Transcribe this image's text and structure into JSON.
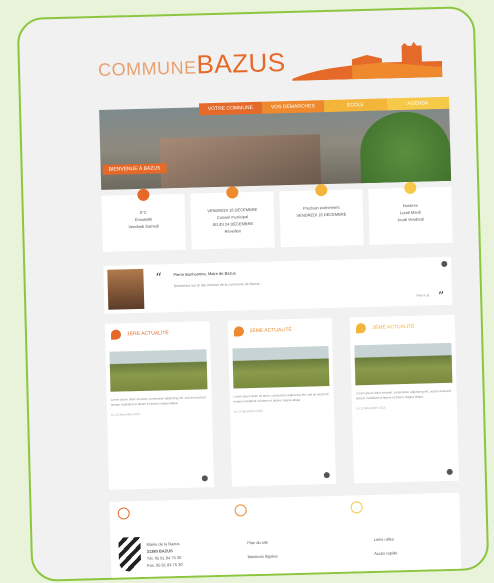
{
  "header": {
    "logo_prefix": "COMMUNE",
    "logo_name": "BAZUS"
  },
  "nav": {
    "items": [
      "VOTRE COMMUNE",
      "VOS DÉMARCHES",
      "ÉCOLE",
      "AGENDA"
    ],
    "colors": [
      "#e56a2a",
      "#ee8a2d",
      "#f3b53a",
      "#f6c949"
    ]
  },
  "hero": {
    "badge": "BIENVENUE À BAZUS"
  },
  "widgets": [
    {
      "icon": "weather-icon",
      "color": "#e56a2a",
      "lines": [
        "8°C",
        "Ensoleillé",
        "Vendredi  Samedi"
      ]
    },
    {
      "icon": "calendar-icon",
      "color": "#ee8a2d",
      "lines": [
        "VENDREDI 18 DÉCEMBRE",
        "Conseil municipal",
        "JEUDI 24 DÉCEMBRE",
        "Réveillon"
      ]
    },
    {
      "icon": "clock-icon",
      "color": "#f3b53a",
      "lines": [
        "Prochain événement",
        "VENDREDI 18 DÉCEMBRE"
      ]
    },
    {
      "icon": "chat-icon",
      "color": "#f6c949",
      "lines": [
        "Horaires",
        "Lundi    Mardi",
        "Jeudi    Vendredi"
      ]
    }
  ],
  "testimonial": {
    "title": "Pierre Bonhomme, Maire de Bazus",
    "body": "Bienvenue sur le site internet de la commune de Bazus.",
    "author": "Pierre B."
  },
  "news": [
    {
      "title": "1ÈRE ACTUALITÉ",
      "color": "#e56a2a",
      "text": "Lorem ipsum dolor sit amet, consectetur adipiscing elit, sed do eiusmod tempor incididunt ut labore et dolore magna aliqua.",
      "date": "Le 12 décembre 2015"
    },
    {
      "title": "2ÈME ACTUALITÉ",
      "color": "#ee8a2d",
      "text": "Lorem ipsum dolor sit amet, consectetur adipiscing elit, sed do eiusmod tempor incididunt ut labore et dolore magna aliqua.",
      "date": "Le 12 décembre 2015"
    },
    {
      "title": "3ÈME ACTUALITÉ",
      "color": "#f3b53a",
      "text": "Lorem ipsum dolor sit amet, consectetur adipiscing elit, sed do eiusmod tempor incididunt ut labore et dolore magna aliqua.",
      "date": "Le 12 décembre 2015"
    }
  ],
  "footer": {
    "address": [
      "Mairie de la Bazus",
      "31380 BAZUS",
      "Tél. 05 61 84 75 30",
      "Fax. 05 61 84 75 30"
    ],
    "links_mid": [
      "Plan du site",
      "Mentions légales"
    ],
    "links_right": [
      "Liens utiles",
      "Accès rapide"
    ],
    "icon_colors": [
      "#e56a2a",
      "#ee8a2d",
      "#f6c949"
    ]
  }
}
